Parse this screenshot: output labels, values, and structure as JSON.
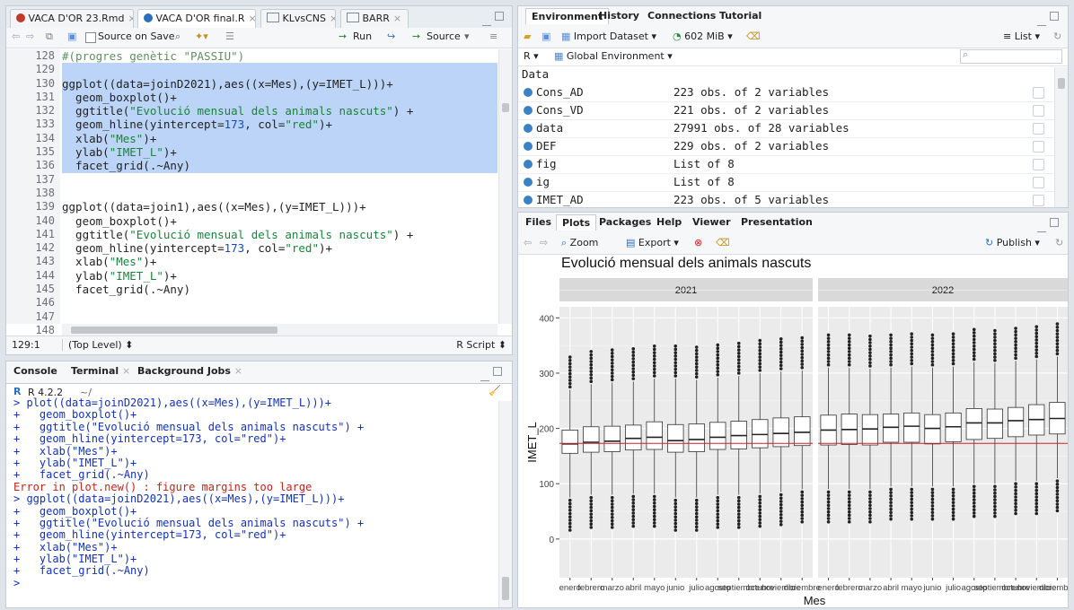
{
  "editor": {
    "tabs": [
      {
        "label": "VACA D'OR 23.Rmd"
      },
      {
        "label": "VACA D'OR final.R"
      },
      {
        "label": "KLvsCNS"
      },
      {
        "label": "BARR"
      }
    ],
    "toolbar": {
      "source_on_save": "Source on Save",
      "run": "Run",
      "source": "Source"
    },
    "line_numbers": [
      "128",
      "129",
      "130",
      "131",
      "132",
      "133",
      "134",
      "135",
      "136",
      "137",
      "138",
      "139",
      "140",
      "141",
      "142",
      "143",
      "144",
      "145",
      "146",
      "147",
      "148"
    ],
    "lines": [
      "#(progres genètic \"PASSIU\")",
      "",
      "ggplot((data=joinD2021),aes((x=Mes),(y=IMET_L)))+",
      "  geom_boxplot()+",
      "  ggtitle(\"Evolució mensual dels animals nascuts\") +",
      "  geom_hline(yintercept=173, col=\"red\")+",
      "  xlab(\"Mes\")+",
      "  ylab(\"IMET_L\")+",
      "  facet_grid(.~Any)",
      "",
      "",
      "ggplot((data=join1),aes((x=Mes),(y=IMET_L)))+",
      "  geom_boxplot()+",
      "  ggtitle(\"Evolució mensual dels animals nascuts\") +",
      "  geom_hline(yintercept=173, col=\"red\")+",
      "  xlab(\"Mes\")+",
      "  ylab(\"IMET_L\")+",
      "  facet_grid(.~Any)",
      "",
      "",
      "  .........(..(......).....(......)....)))"
    ],
    "status": {
      "position": "129:1",
      "scope": "(Top Level)",
      "type": "R Script"
    }
  },
  "console": {
    "tabs": [
      {
        "label": "Console"
      },
      {
        "label": "Terminal"
      },
      {
        "label": "Background Jobs"
      }
    ],
    "r_version": "R 4.2.2",
    "path": "~/",
    "lines": [
      {
        "text": "> plot((data=joinD2021),aes((x=Mes),(y=IMET_L)))+",
        "cls": "blue"
      },
      {
        "text": "+   geom_boxplot()+",
        "cls": "blue"
      },
      {
        "text": "+   ggtitle(\"Evolució mensual dels animals nascuts\") +",
        "cls": "blue"
      },
      {
        "text": "+   geom_hline(yintercept=173, col=\"red\")+",
        "cls": "blue"
      },
      {
        "text": "+   xlab(\"Mes\")+",
        "cls": "blue"
      },
      {
        "text": "+   ylab(\"IMET_L\")+",
        "cls": "blue"
      },
      {
        "text": "+   facet_grid(.~Any)",
        "cls": "blue"
      },
      {
        "text": "Error in plot.new() : figure margins too large",
        "cls": "red"
      },
      {
        "text": "> ggplot((data=joinD2021),aes((x=Mes),(y=IMET_L)))+",
        "cls": "blue"
      },
      {
        "text": "+   geom_boxplot()+",
        "cls": "blue"
      },
      {
        "text": "+   ggtitle(\"Evolució mensual dels animals nascuts\") +",
        "cls": "blue"
      },
      {
        "text": "+   geom_hline(yintercept=173, col=\"red\")+",
        "cls": "blue"
      },
      {
        "text": "+   xlab(\"Mes\")+",
        "cls": "blue"
      },
      {
        "text": "+   ylab(\"IMET_L\")+",
        "cls": "blue"
      },
      {
        "text": "+   facet_grid(.~Any)",
        "cls": "blue"
      },
      {
        "text": ">",
        "cls": "blue"
      }
    ]
  },
  "environment": {
    "tabs": [
      {
        "label": "Environment"
      },
      {
        "label": "History"
      },
      {
        "label": "Connections"
      },
      {
        "label": "Tutorial"
      }
    ],
    "import_dataset": "Import Dataset",
    "memory": "602 MiB",
    "list_view": "List",
    "r_selector": "R",
    "global_env": "Global Environment",
    "search_placeholder": "",
    "section": "Data",
    "rows": [
      {
        "name": "Cons_AD",
        "value": "223 obs. of 2 variables"
      },
      {
        "name": "Cons_VD",
        "value": "221 obs. of 2 variables"
      },
      {
        "name": "data",
        "value": "27991 obs. of 28 variables"
      },
      {
        "name": "DEF",
        "value": "229 obs. of 2 variables"
      },
      {
        "name": "fig",
        "value": "List of  8"
      },
      {
        "name": "ig",
        "value": "List of  8"
      },
      {
        "name": "IMET_AD",
        "value": "223 obs. of 5 variables"
      }
    ]
  },
  "plots_pane": {
    "tabs": [
      {
        "label": "Files"
      },
      {
        "label": "Plots"
      },
      {
        "label": "Packages"
      },
      {
        "label": "Help"
      },
      {
        "label": "Viewer"
      },
      {
        "label": "Presentation"
      }
    ],
    "zoom": "Zoom",
    "export": "Export",
    "publish": "Publish"
  },
  "chart_data": {
    "type": "boxplot",
    "title": "Evolució mensual dels animals nascuts",
    "xlabel": "Mes",
    "ylabel": "IMET_L",
    "ylim": [
      -70,
      420
    ],
    "yticks": [
      0,
      100,
      200,
      300,
      400
    ],
    "hline": 173,
    "hline_color": "#cc2222",
    "facets": [
      "2021",
      "2022"
    ],
    "categories": [
      "enero",
      "febrero",
      "marzo",
      "abril",
      "mayo",
      "junio",
      "julio",
      "agosto",
      "septiembre",
      "octubre",
      "noviembre",
      "diciembre"
    ],
    "series": [
      {
        "name": "2021",
        "boxes": [
          {
            "q1": 155,
            "median": 172,
            "q3": 197,
            "low": 75,
            "high": 270
          },
          {
            "q1": 157,
            "median": 175,
            "q3": 203,
            "low": 80,
            "high": 280
          },
          {
            "q1": 158,
            "median": 177,
            "q3": 204,
            "low": 80,
            "high": 283
          },
          {
            "q1": 161,
            "median": 182,
            "q3": 206,
            "low": 82,
            "high": 285
          },
          {
            "q1": 162,
            "median": 184,
            "q3": 212,
            "low": 82,
            "high": 290
          },
          {
            "q1": 157,
            "median": 178,
            "q3": 207,
            "low": 75,
            "high": 290
          },
          {
            "q1": 158,
            "median": 180,
            "q3": 208,
            "low": 75,
            "high": 288
          },
          {
            "q1": 162,
            "median": 184,
            "q3": 211,
            "low": 80,
            "high": 292
          },
          {
            "q1": 163,
            "median": 187,
            "q3": 213,
            "low": 80,
            "high": 295
          },
          {
            "q1": 165,
            "median": 189,
            "q3": 216,
            "low": 82,
            "high": 300
          },
          {
            "q1": 167,
            "median": 191,
            "q3": 219,
            "low": 85,
            "high": 303
          },
          {
            "q1": 169,
            "median": 193,
            "q3": 221,
            "low": 90,
            "high": 305
          }
        ]
      },
      {
        "name": "2022",
        "boxes": [
          {
            "q1": 170,
            "median": 197,
            "q3": 224,
            "low": 90,
            "high": 310
          },
          {
            "q1": 171,
            "median": 198,
            "q3": 226,
            "low": 90,
            "high": 310
          },
          {
            "q1": 170,
            "median": 199,
            "q3": 225,
            "low": 90,
            "high": 308
          },
          {
            "q1": 175,
            "median": 202,
            "q3": 226,
            "low": 95,
            "high": 310
          },
          {
            "q1": 175,
            "median": 204,
            "q3": 228,
            "low": 95,
            "high": 312
          },
          {
            "q1": 172,
            "median": 200,
            "q3": 225,
            "low": 95,
            "high": 310
          },
          {
            "q1": 176,
            "median": 203,
            "q3": 228,
            "low": 95,
            "high": 312
          },
          {
            "q1": 180,
            "median": 210,
            "q3": 236,
            "low": 100,
            "high": 320
          },
          {
            "q1": 182,
            "median": 210,
            "q3": 235,
            "low": 100,
            "high": 318
          },
          {
            "q1": 185,
            "median": 214,
            "q3": 238,
            "low": 105,
            "high": 322
          },
          {
            "q1": 188,
            "median": 216,
            "q3": 243,
            "low": 105,
            "high": 325
          },
          {
            "q1": 190,
            "median": 218,
            "q3": 247,
            "low": 110,
            "high": 330
          }
        ]
      }
    ]
  }
}
